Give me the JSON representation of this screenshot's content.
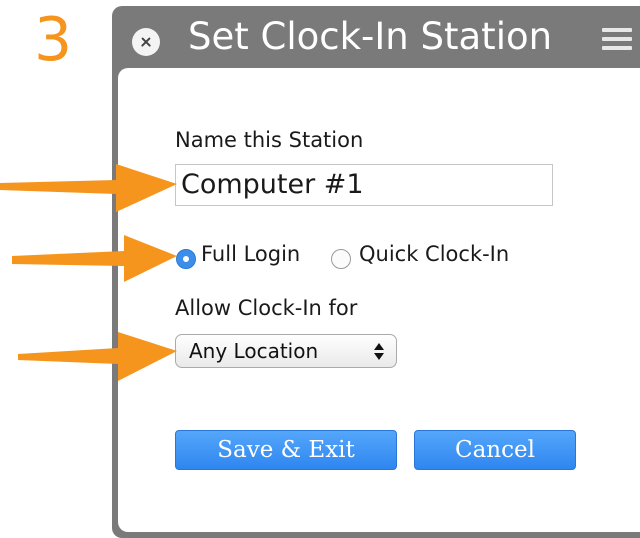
{
  "step_number": "3",
  "dialog": {
    "title": "Set Clock-In Station",
    "close_icon": "close-icon",
    "menu_icon": "hamburger-menu-icon"
  },
  "form": {
    "name_label": "Name this Station",
    "name_value": "Computer #1",
    "login_options": [
      {
        "label": "Full Login",
        "checked": true
      },
      {
        "label": "Quick Clock-In",
        "checked": false
      }
    ],
    "allow_label": "Allow Clock-In for",
    "allow_selected": "Any Location"
  },
  "buttons": {
    "save": "Save & Exit",
    "cancel": "Cancel"
  },
  "colors": {
    "step_number": "#f5951d",
    "arrow": "#f5951d",
    "titlebar": "#7a7a7a",
    "button": "#3a8ff2",
    "radio_checked": "#3b8eea"
  }
}
